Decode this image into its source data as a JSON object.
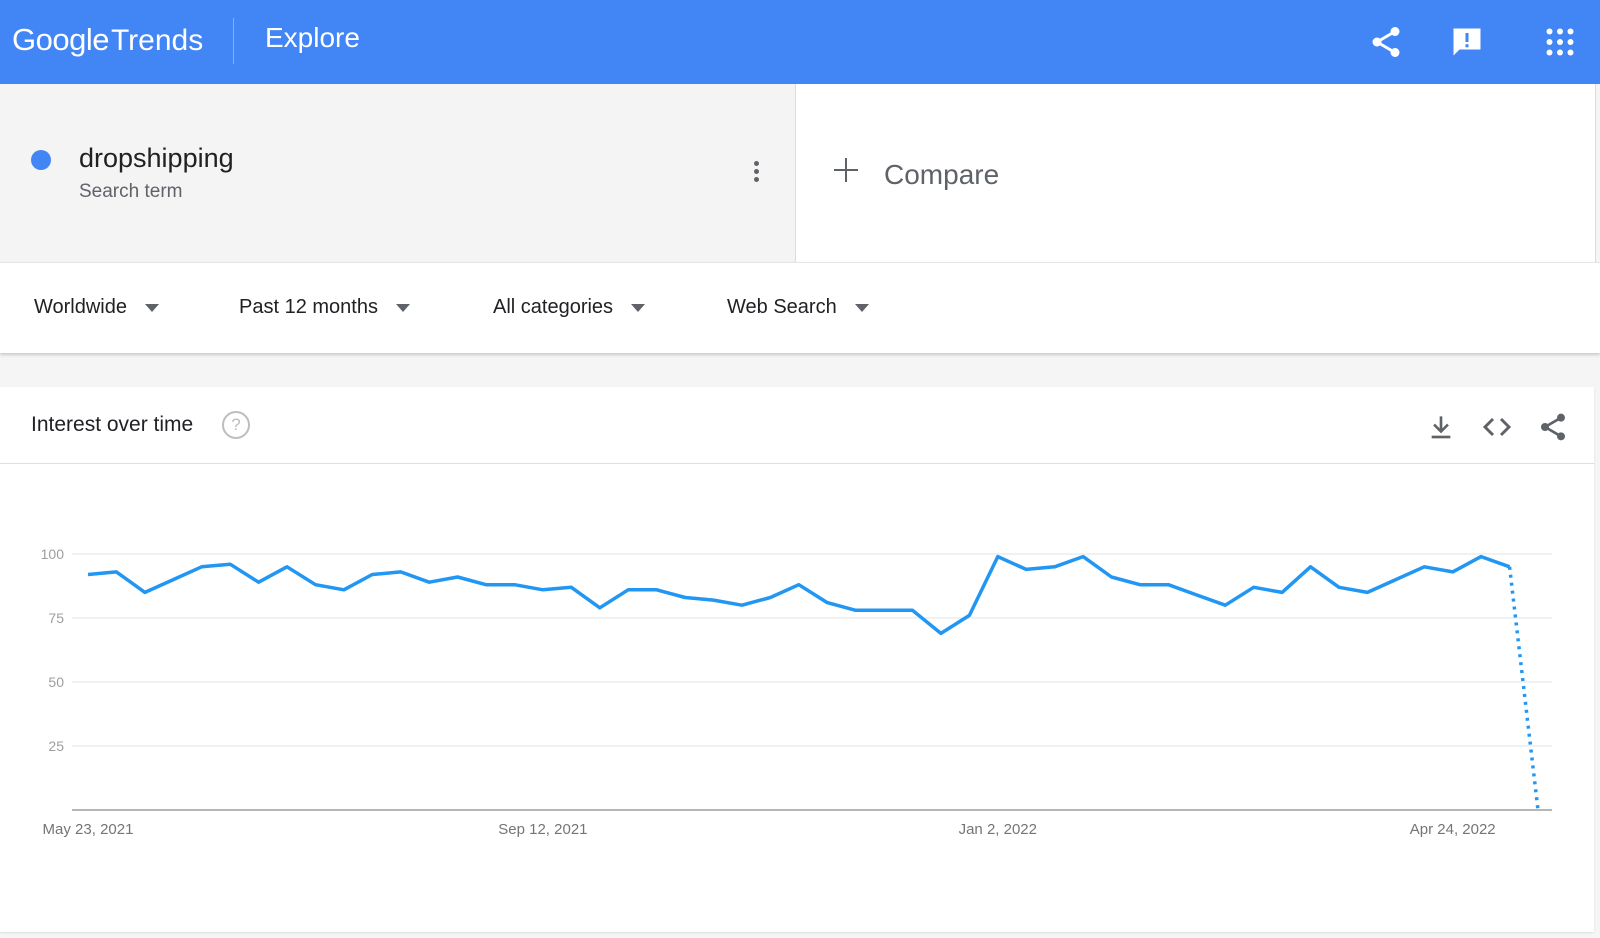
{
  "header": {
    "logo_google": "Google",
    "logo_trends": "Trends",
    "page_title": "Explore",
    "icons": [
      "share-icon",
      "feedback-icon",
      "apps-icon"
    ],
    "bg_color": "#4285f4"
  },
  "search_term": {
    "name": "dropshipping",
    "type": "Search term",
    "color": "#4285f4"
  },
  "compare": {
    "label": "Compare"
  },
  "filters": {
    "region": "Worldwide",
    "time_range": "Past 12 months",
    "category": "All categories",
    "search_type": "Web Search"
  },
  "card": {
    "title": "Interest over time",
    "help_glyph": "?",
    "actions": [
      "download-icon",
      "embed-icon",
      "share-icon"
    ]
  },
  "chart_data": {
    "type": "line",
    "title": "Interest over time",
    "x_tick_labels": [
      "May 23, 2021",
      "Sep 12, 2021",
      "Jan 2, 2022",
      "Apr 24, 2022"
    ],
    "y_ticks": [
      25,
      50,
      75,
      100
    ],
    "ylim": [
      0,
      100
    ],
    "grid": true,
    "series": [
      {
        "name": "dropshipping",
        "color": "#2196f3",
        "values": [
          92,
          93,
          85,
          90,
          95,
          96,
          89,
          95,
          88,
          86,
          92,
          93,
          89,
          91,
          88,
          88,
          86,
          87,
          79,
          86,
          86,
          83,
          82,
          80,
          83,
          88,
          81,
          78,
          78,
          78,
          69,
          76,
          99,
          94,
          95,
          99,
          91,
          88,
          88,
          84,
          80,
          87,
          85,
          95,
          87,
          85,
          90,
          95,
          93,
          99,
          95
        ],
        "partial_last": 0
      }
    ]
  }
}
